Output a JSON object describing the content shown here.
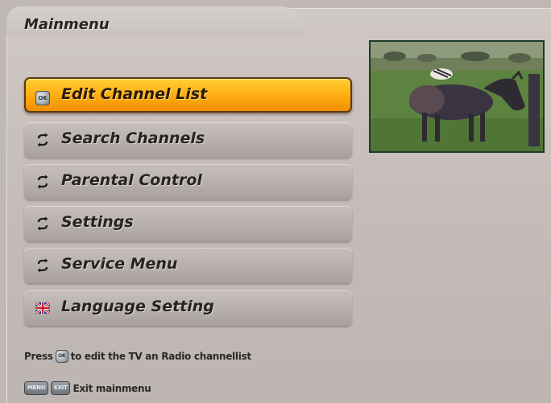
{
  "window": {
    "title": "Mainmenu"
  },
  "menu": {
    "items": [
      {
        "label": "Edit Channel List",
        "icon": "ok-key-icon",
        "selected": true
      },
      {
        "label": "Search Channels",
        "icon": "arrows-icon",
        "selected": false
      },
      {
        "label": "Parental Control",
        "icon": "arrows-icon",
        "selected": false
      },
      {
        "label": "Settings",
        "icon": "arrows-icon",
        "selected": false
      },
      {
        "label": "Service Menu",
        "icon": "arrows-icon",
        "selected": false
      },
      {
        "label": "Language Setting",
        "icon": "uk-flag-icon",
        "selected": false
      }
    ]
  },
  "hint": {
    "prefix": "Press",
    "key": "OK",
    "suffix": "to edit the TV an Radio channellist"
  },
  "footer": {
    "key_menu": "MENU",
    "key_exit": "EXIT",
    "label": "Exit mainmenu"
  },
  "preview": {
    "content": "live-tv-preview-wildebeest"
  },
  "colors": {
    "accent": "#ffb114",
    "panel": "#c4bcb9",
    "text": "#272223",
    "preview_border": "#1d3b27"
  }
}
